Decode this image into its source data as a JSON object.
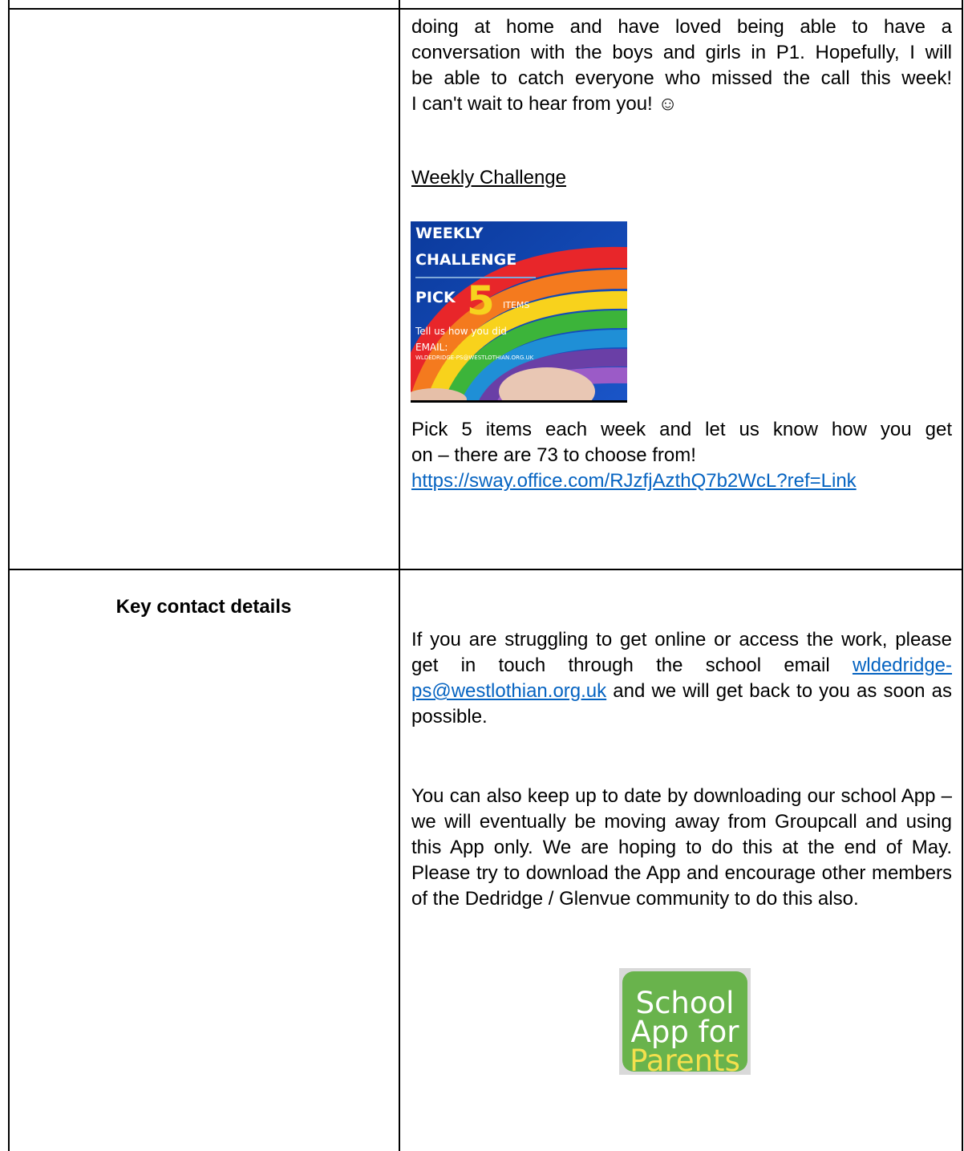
{
  "top_row": {
    "intro_lines": [
      "doing at home and have loved being able to have a",
      "conversation with the boys and girls in P1. Hopefully, I will",
      "be able to catch everyone who missed the call this week!",
      "I can't wait to hear from you! ☺"
    ],
    "challenge_heading": "Weekly Challenge",
    "challenge_image": {
      "line1": "WEEKLY",
      "line2": "CHALLENGE",
      "pick": "PICK",
      "number": "5",
      "items": "ITEMS",
      "tell": "Tell us how you did",
      "email_label": "EMAIL:",
      "email": "WLDEDRIDGE-PS@WESTLOTHIAN.ORG.UK"
    },
    "challenge_text_line1": "Pick 5 items each week and let us know how you get",
    "challenge_text_line2": "on – there are 73 to choose from!",
    "challenge_link": "https://sway.office.com/RJzfjAzthQ7b2WcL?ref=Link"
  },
  "contact_row": {
    "title": "Key contact details",
    "para1_before": "If you are struggling to get online or access the work, please get in touch through the school email",
    "para1_email": "wldedridge-ps@westlothian.org.uk",
    "para1_after": "and we will get back to you as soon as possible.",
    "para2": "You can also keep up to date by downloading our school App – we will eventually be moving away from Groupcall and using this App only. We are hoping to do this at the end of May. Please try to download the App and encourage other members of the Dedridge / Glenvue community to do this also.",
    "app_icon": {
      "line1": "School",
      "line2": "App for",
      "line3": "Parents"
    }
  },
  "colors": {
    "link": "#0563c1",
    "app_green": "#69b34c",
    "app_yellow": "#f4e04d",
    "border": "#000000"
  }
}
